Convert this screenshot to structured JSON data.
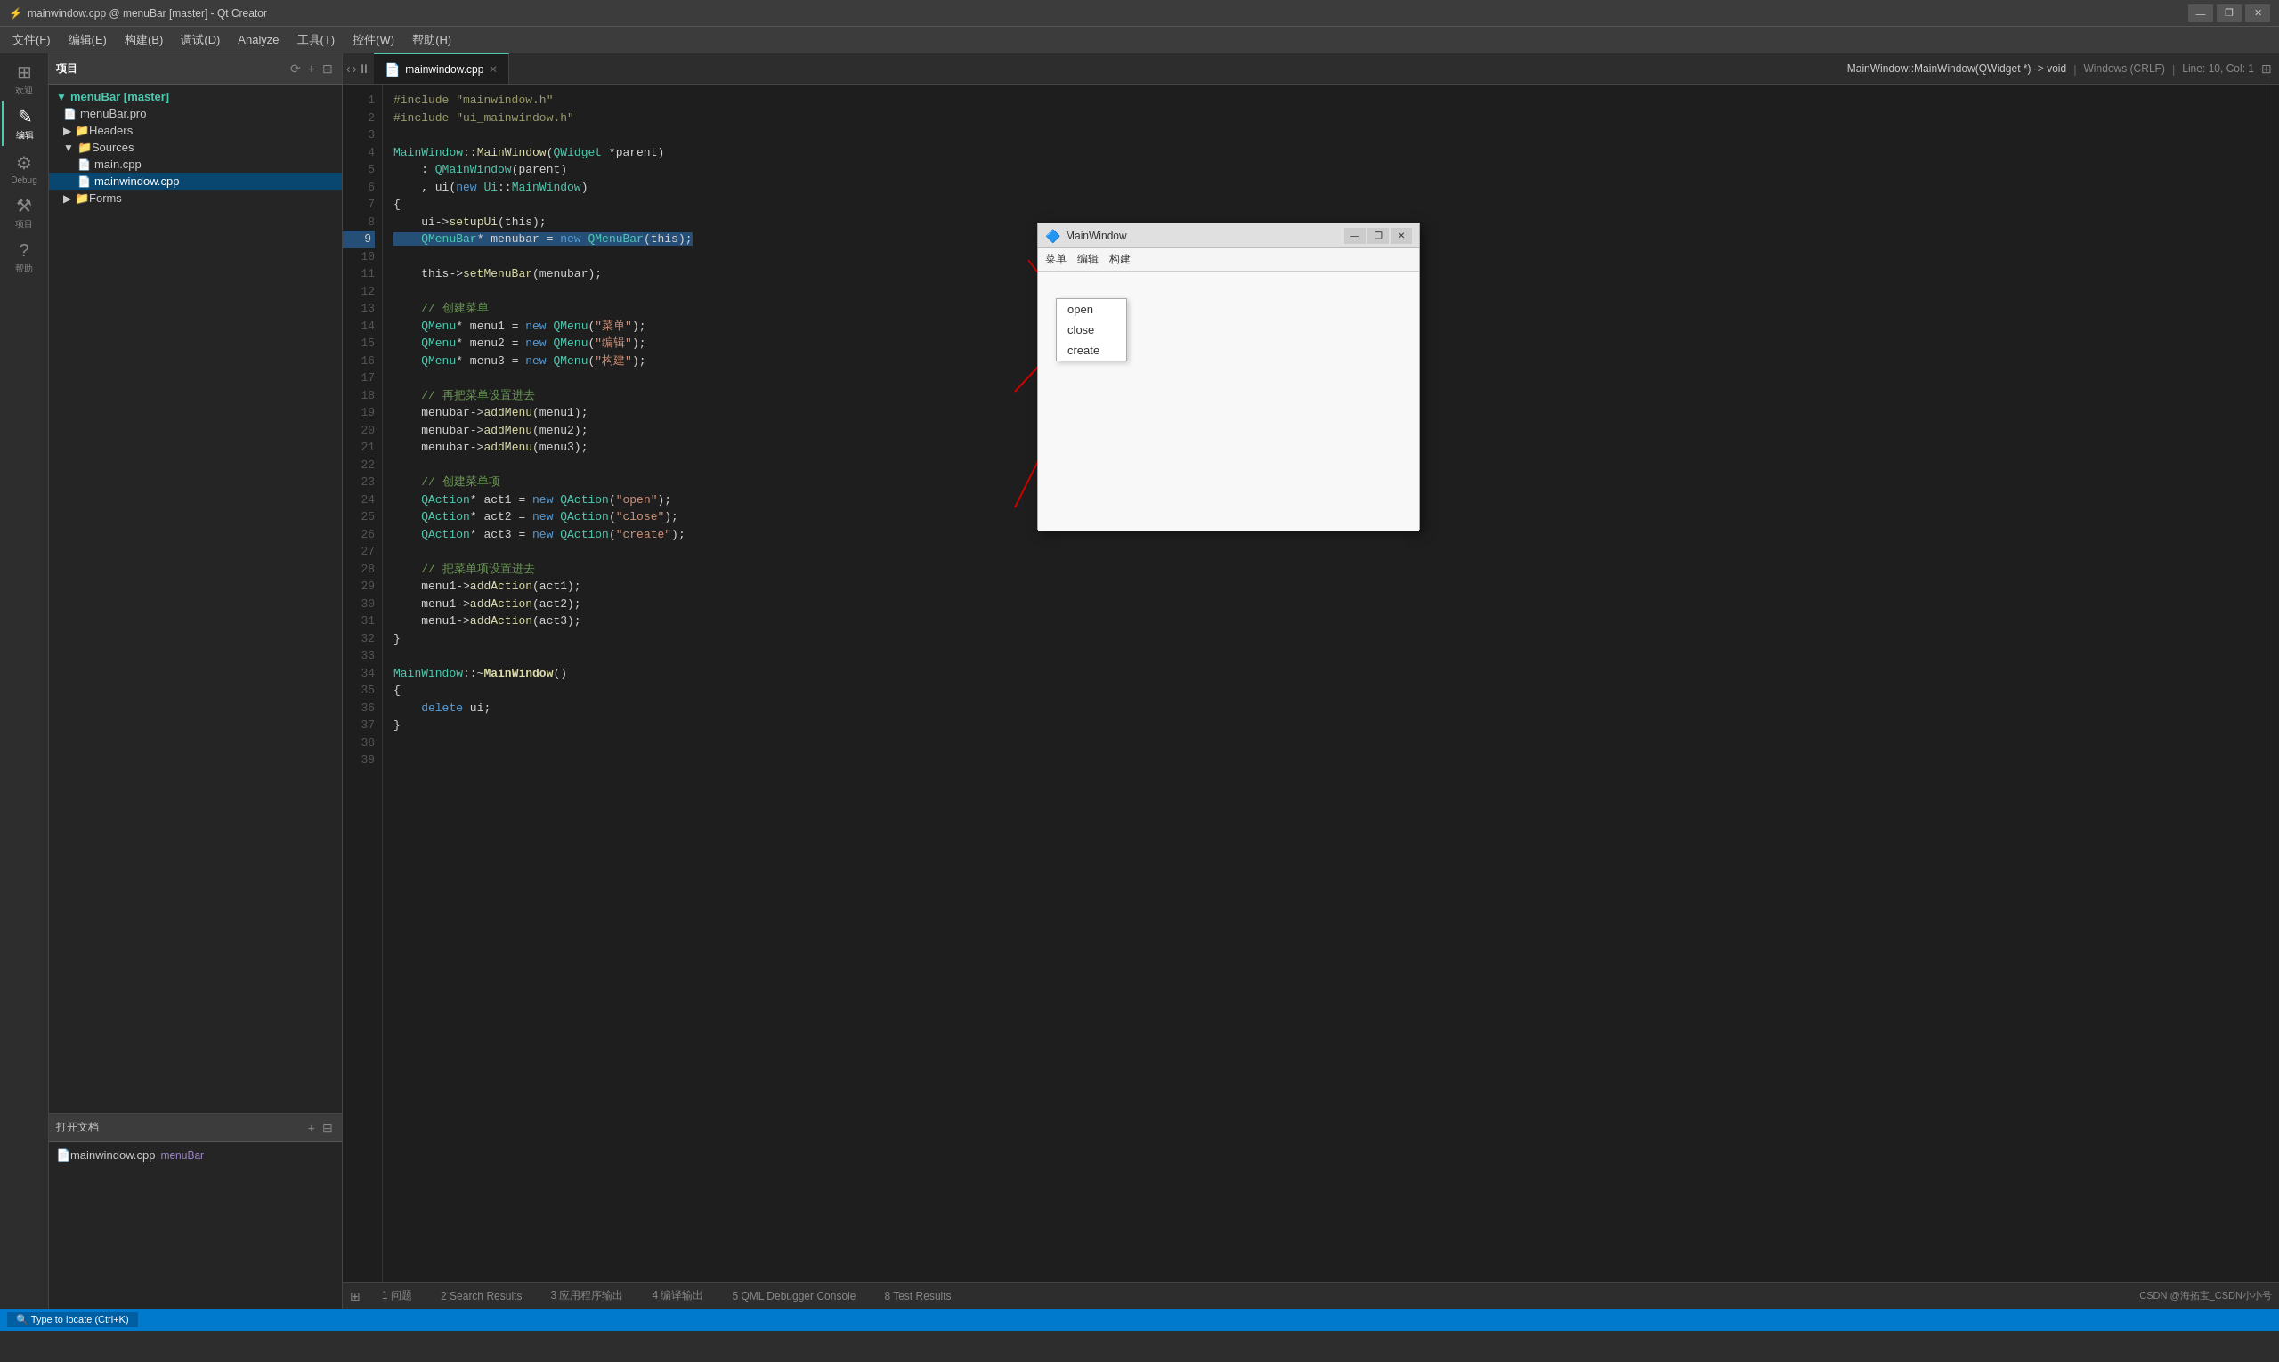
{
  "titleBar": {
    "title": "mainwindow.cpp @ menuBar [master] - Qt Creator",
    "controls": [
      "—",
      "❐",
      "✕"
    ]
  },
  "menuBar": {
    "items": [
      "文件(F)",
      "编辑(E)",
      "构建(B)",
      "调试(D)",
      "Analyze",
      "工具(T)",
      "控件(W)",
      "帮助(H)"
    ]
  },
  "activityBar": {
    "items": [
      {
        "icon": "⊞",
        "label": "欢迎"
      },
      {
        "icon": "✎",
        "label": "编辑"
      },
      {
        "icon": "⚙",
        "label": "Debug"
      },
      {
        "icon": "⚒",
        "label": "项目"
      },
      {
        "icon": "?",
        "label": "帮助"
      }
    ]
  },
  "sidebar": {
    "header": "项目",
    "tree": [
      {
        "indent": 0,
        "icon": "▼",
        "color": "#4ec9b0",
        "label": "menuBar [master]",
        "type": "root"
      },
      {
        "indent": 1,
        "icon": "📄",
        "label": "menuBar.pro",
        "type": "file"
      },
      {
        "indent": 1,
        "icon": "▶",
        "label": "Headers",
        "type": "folder"
      },
      {
        "indent": 1,
        "icon": "▼",
        "color": "#f0c040",
        "label": "Sources",
        "type": "folder",
        "expanded": true
      },
      {
        "indent": 2,
        "icon": "📄",
        "label": "main.cpp",
        "type": "file"
      },
      {
        "indent": 2,
        "icon": "📄",
        "label": "mainwindow.cpp",
        "type": "file",
        "selected": true
      },
      {
        "indent": 1,
        "icon": "▶",
        "label": "Forms",
        "type": "folder"
      }
    ]
  },
  "openDocs": {
    "header": "打开文档",
    "items": [
      {
        "label": "mainwindow.cpp",
        "sublabel": "menuBar"
      }
    ]
  },
  "tabBar": {
    "tabs": [
      {
        "label": "mainwindow.cpp",
        "active": true
      }
    ],
    "breadcrumb": "MainWindow::MainWindow(QWidget *) -> void",
    "encoding": "Windows (CRLF)",
    "position": "Line: 10, Col: 1"
  },
  "codeLines": [
    {
      "num": 1,
      "content": "#include \"mainwindow.h\"",
      "type": "include"
    },
    {
      "num": 2,
      "content": "#include \"ui_mainwindow.h\"",
      "type": "include"
    },
    {
      "num": 3,
      "content": "",
      "type": "blank"
    },
    {
      "num": 4,
      "content": "MainWindow::MainWindow(QWidget *parent)",
      "type": "code"
    },
    {
      "num": 5,
      "content": "    : QMainWindow(parent)",
      "type": "code"
    },
    {
      "num": 6,
      "content": "    , ui(new Ui::MainWindow)",
      "type": "code"
    },
    {
      "num": 7,
      "content": "{",
      "type": "code"
    },
    {
      "num": 8,
      "content": "    ui->setupUi(this);",
      "type": "code"
    },
    {
      "num": 9,
      "content": "    QMenuBar* menubar = new QMenuBar(this);",
      "type": "code",
      "highlight": true
    },
    {
      "num": 10,
      "content": "",
      "type": "blank"
    },
    {
      "num": 11,
      "content": "    this->setMenuBar(menubar);",
      "type": "code"
    },
    {
      "num": 12,
      "content": "",
      "type": "blank"
    },
    {
      "num": 13,
      "content": "    // 创建菜单",
      "type": "comment"
    },
    {
      "num": 14,
      "content": "    QMenu* menu1 = new QMenu(\"菜单\");",
      "type": "code"
    },
    {
      "num": 15,
      "content": "    QMenu* menu2 = new QMenu(\"编辑\");",
      "type": "code"
    },
    {
      "num": 16,
      "content": "    QMenu* menu3 = new QMenu(\"构建\");",
      "type": "code"
    },
    {
      "num": 17,
      "content": "",
      "type": "blank"
    },
    {
      "num": 18,
      "content": "    // 再把菜单设置进去",
      "type": "comment"
    },
    {
      "num": 19,
      "content": "    menubar->addMenu(menu1);",
      "type": "code"
    },
    {
      "num": 20,
      "content": "    menubar->addMenu(menu2);",
      "type": "code"
    },
    {
      "num": 21,
      "content": "    menubar->addMenu(menu3);",
      "type": "code"
    },
    {
      "num": 22,
      "content": "",
      "type": "blank"
    },
    {
      "num": 23,
      "content": "    // 创建菜单项",
      "type": "comment"
    },
    {
      "num": 24,
      "content": "    QAction* act1 = new QAction(\"open\");",
      "type": "code"
    },
    {
      "num": 25,
      "content": "    QAction* act2 = new QAction(\"close\");",
      "type": "code"
    },
    {
      "num": 26,
      "content": "    QAction* act3 = new QAction(\"create\");",
      "type": "code"
    },
    {
      "num": 27,
      "content": "",
      "type": "blank"
    },
    {
      "num": 28,
      "content": "    // 把菜单项设置进去",
      "type": "comment"
    },
    {
      "num": 29,
      "content": "    menu1->addAction(act1);",
      "type": "code"
    },
    {
      "num": 30,
      "content": "    menu1->addAction(act2);",
      "type": "code"
    },
    {
      "num": 31,
      "content": "    menu1->addAction(act3);",
      "type": "code"
    },
    {
      "num": 32,
      "content": "}",
      "type": "code"
    },
    {
      "num": 33,
      "content": "",
      "type": "blank"
    },
    {
      "num": 34,
      "content": "MainWindow::~MainWindow()",
      "type": "code"
    },
    {
      "num": 35,
      "content": "{",
      "type": "code"
    },
    {
      "num": 36,
      "content": "    delete ui;",
      "type": "code"
    },
    {
      "num": 37,
      "content": "}",
      "type": "code"
    },
    {
      "num": 38,
      "content": "",
      "type": "blank"
    },
    {
      "num": 39,
      "content": "",
      "type": "blank"
    }
  ],
  "previewWindow": {
    "title": "MainWindow",
    "menuItems": [
      "菜单",
      "编辑",
      "构建"
    ],
    "dropdownItems": [
      "open",
      "close",
      "create"
    ]
  },
  "bottomPanel": {
    "tabs": [
      "1 问题",
      "2 Search Results",
      "3 应用程序输出",
      "4 编译输出",
      "5 QML Debugger Console",
      "8 Test Results"
    ]
  },
  "statusBar": {
    "left": "CSDN @海拓宝_CSDN小小号",
    "right": ""
  }
}
